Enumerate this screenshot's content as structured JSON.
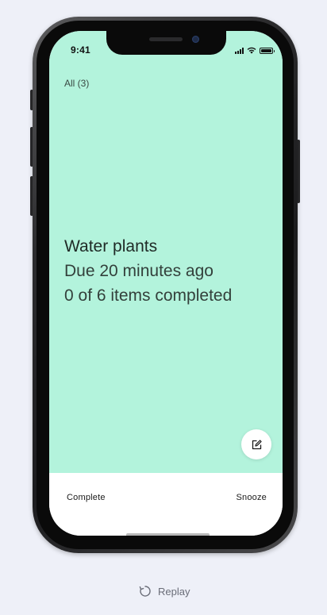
{
  "status_bar": {
    "time": "9:41",
    "icons": [
      "signal-icon",
      "wifi-icon",
      "battery-icon"
    ],
    "battery_level": 1.0
  },
  "header": {
    "filter_label": "All (3)"
  },
  "task": {
    "title": "Water plants",
    "due": "Due 20 minutes ago",
    "progress": "0 of 6 items completed",
    "card_color": "#b3f3dc"
  },
  "fab": {
    "icon": "edit-icon"
  },
  "actions": {
    "complete_label": "Complete",
    "snooze_label": "Snooze"
  },
  "replay": {
    "icon": "replay-icon",
    "label": "Replay"
  }
}
